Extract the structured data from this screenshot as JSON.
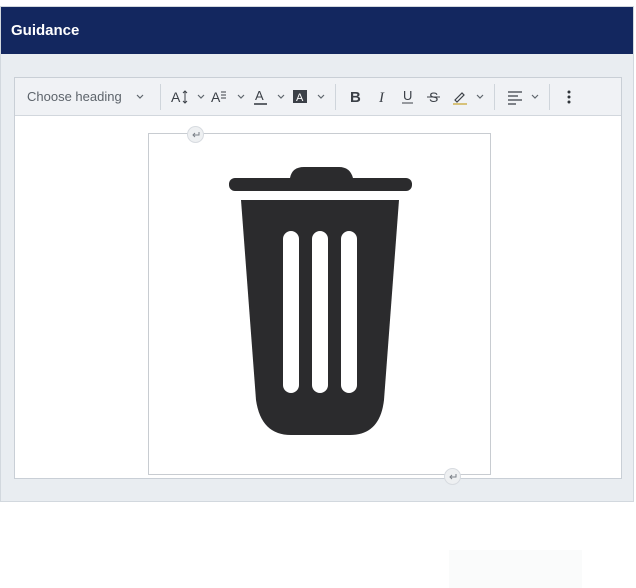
{
  "panel": {
    "title": "Guidance"
  },
  "toolbar": {
    "heading_select": {
      "label": "Choose heading",
      "options_visible": [
        "Choose heading"
      ],
      "chevron_icon": "chevron-down"
    },
    "groups": [
      {
        "items": [
          {
            "name": "font-size-icon",
            "glyph": "A↕",
            "dropdown": true
          },
          {
            "name": "font-family-icon",
            "glyph": "A≡",
            "dropdown": true
          },
          {
            "name": "font-color-icon",
            "glyph": "A",
            "dropdown": true
          },
          {
            "name": "font-background-icon",
            "glyph": "A",
            "dropdown": true
          }
        ]
      },
      {
        "items": [
          {
            "name": "bold-icon",
            "glyph": "B"
          },
          {
            "name": "italic-icon",
            "glyph": "I"
          },
          {
            "name": "underline-icon",
            "glyph": "U"
          },
          {
            "name": "strikethrough-icon",
            "glyph": "S"
          },
          {
            "name": "highlight-icon",
            "glyph": "✎",
            "dropdown": true
          }
        ]
      },
      {
        "items": [
          {
            "name": "align-icon",
            "glyph": "≡",
            "dropdown": true
          }
        ]
      }
    ],
    "more_icon": "vertical-dots"
  },
  "content": {
    "image": {
      "alt": "Trash can icon"
    }
  },
  "colors": {
    "header_bg": "#13275f",
    "header_text": "#ffffff",
    "panel_bg": "#e9edf1",
    "toolbar_bg": "#f0f2f5",
    "icon_color": "#3b4047",
    "trash_color": "#2b2b2d"
  }
}
